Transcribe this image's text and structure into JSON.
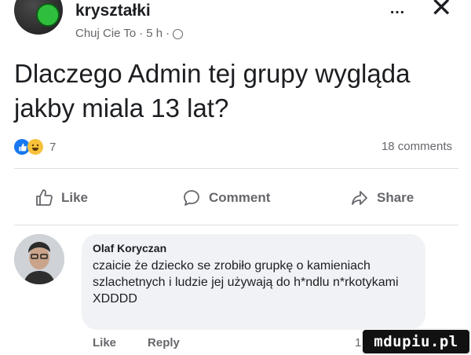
{
  "post": {
    "group_name": "kryształki",
    "author": "Chuj Cie To",
    "time": "5 h",
    "separator": "·",
    "text": "Dlaczego Admin tej grupy wygląda jakby miala 13 lat?",
    "reaction_count": "7",
    "comments_count": "18 comments",
    "more_icon": "…",
    "close_icon": "✕"
  },
  "actions": {
    "like": "Like",
    "comment": "Comment",
    "share": "Share"
  },
  "comment": {
    "author": "Olaf Koryczan",
    "text": "czaicie że dziecko se zrobiło grupkę o kamieniach szlachetnych i ludzie jej używają do h*ndlu n*rkotykami XDDDD",
    "like_label": "Like",
    "reply_label": "Reply",
    "count": "1"
  },
  "watermark": {
    "text": "mdupiu.pl"
  },
  "colors": {
    "text": "#1c1e21",
    "secondary": "#65676b",
    "like_blue": "#1877f2",
    "bubble": "#f0f2f5"
  },
  "icons": [
    "more-icon",
    "close-icon",
    "globe-icon",
    "like-reaction-icon",
    "haha-reaction-icon",
    "like-icon",
    "comment-icon",
    "share-icon"
  ]
}
